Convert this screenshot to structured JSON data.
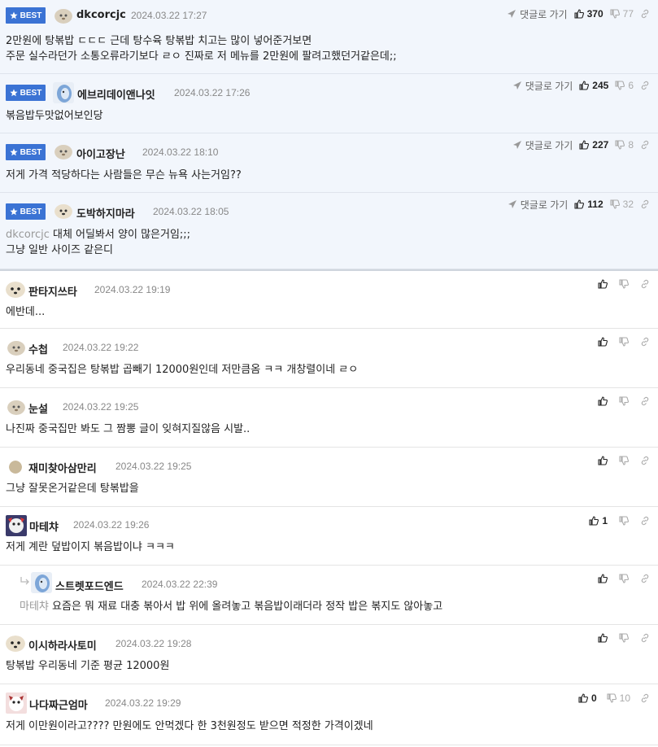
{
  "best_label": "BEST",
  "reply_go_label": "댓글로 가기",
  "comments": [
    {
      "best": true,
      "nick": "dkcorcjc",
      "date": "2024.03.22 17:27",
      "up": "370",
      "down": "77",
      "lines": [
        "2만원에 탕볶밥 ㄷㄷㄷ 근데 탕수육 탕볶밥 치고는 많이 넣어준거보면",
        "주문 실수라던가 소통오류라기보다 ㄹㅇ 진짜로 저 메뉴를 2만원에 팔려고했던거같은데;;"
      ]
    },
    {
      "best": true,
      "nick": "에브리데이앤나잇",
      "date": "2024.03.22 17:26",
      "up": "245",
      "down": "6",
      "lines": [
        "볶음밥두맛없어보인당"
      ]
    },
    {
      "best": true,
      "nick": "아이고장난",
      "date": "2024.03.22 18:10",
      "up": "227",
      "down": "8",
      "lines": [
        "저게 가격 적당하다는 사람들은 무슨 뉴욕 사는거임??"
      ]
    },
    {
      "best": true,
      "nick": "도박하지마라",
      "date": "2024.03.22 18:05",
      "up": "112",
      "down": "32",
      "mention": "dkcorcjc",
      "lines": [
        "대체 어딜봐서 양이 많은거임;;;",
        "그냥 일반 사이즈 같은디"
      ]
    },
    {
      "nick": "판타지쓰타",
      "date": "2024.03.22 19:19",
      "lines": [
        "에반데..."
      ]
    },
    {
      "nick": "수첩",
      "date": "2024.03.22 19:22",
      "lines": [
        "우리동네 중국집은 탕볶밥 곱빼기 12000원인데 저만큼옴 ㅋㅋ 개창렬이네 ㄹㅇ"
      ]
    },
    {
      "nick": "눈설",
      "date": "2024.03.22 19:25",
      "lines": [
        "나진짜 중국집만 봐도 그 짬뽕 글이 잊혀지질않음 시발.."
      ]
    },
    {
      "nick": "재미찾아삼만리",
      "date": "2024.03.22 19:25",
      "lines": [
        "그냥 잘못온거같은데 탕볶밥을"
      ]
    },
    {
      "nick": "마테챠",
      "date": "2024.03.22 19:26",
      "up": "1",
      "lines": [
        "저게 계란 덮밥이지 볶음밥이냐 ㅋㅋㅋ"
      ]
    },
    {
      "reply": true,
      "nick": "스트렛포드엔드",
      "date": "2024.03.22 22:39",
      "mention": "마테챠",
      "lines": [
        "요즘은 뭐 재료 대충 볶아서 밥 위에 올려놓고 볶음밥이래더라 정작 밥은 볶지도 않아놓고"
      ]
    },
    {
      "nick": "이시하라사토미",
      "date": "2024.03.22 19:28",
      "lines": [
        "탕볶밥 우리동네 기준 평균 12000원"
      ]
    },
    {
      "nick": "나다짜근엄마",
      "date": "2024.03.22 19:29",
      "up": "0",
      "down": "10",
      "lines": [
        "저게 이만원이라고???? 만원에도 안먹겠다 한 3천원정도 받으면 적정한 가격이겠네"
      ]
    }
  ]
}
